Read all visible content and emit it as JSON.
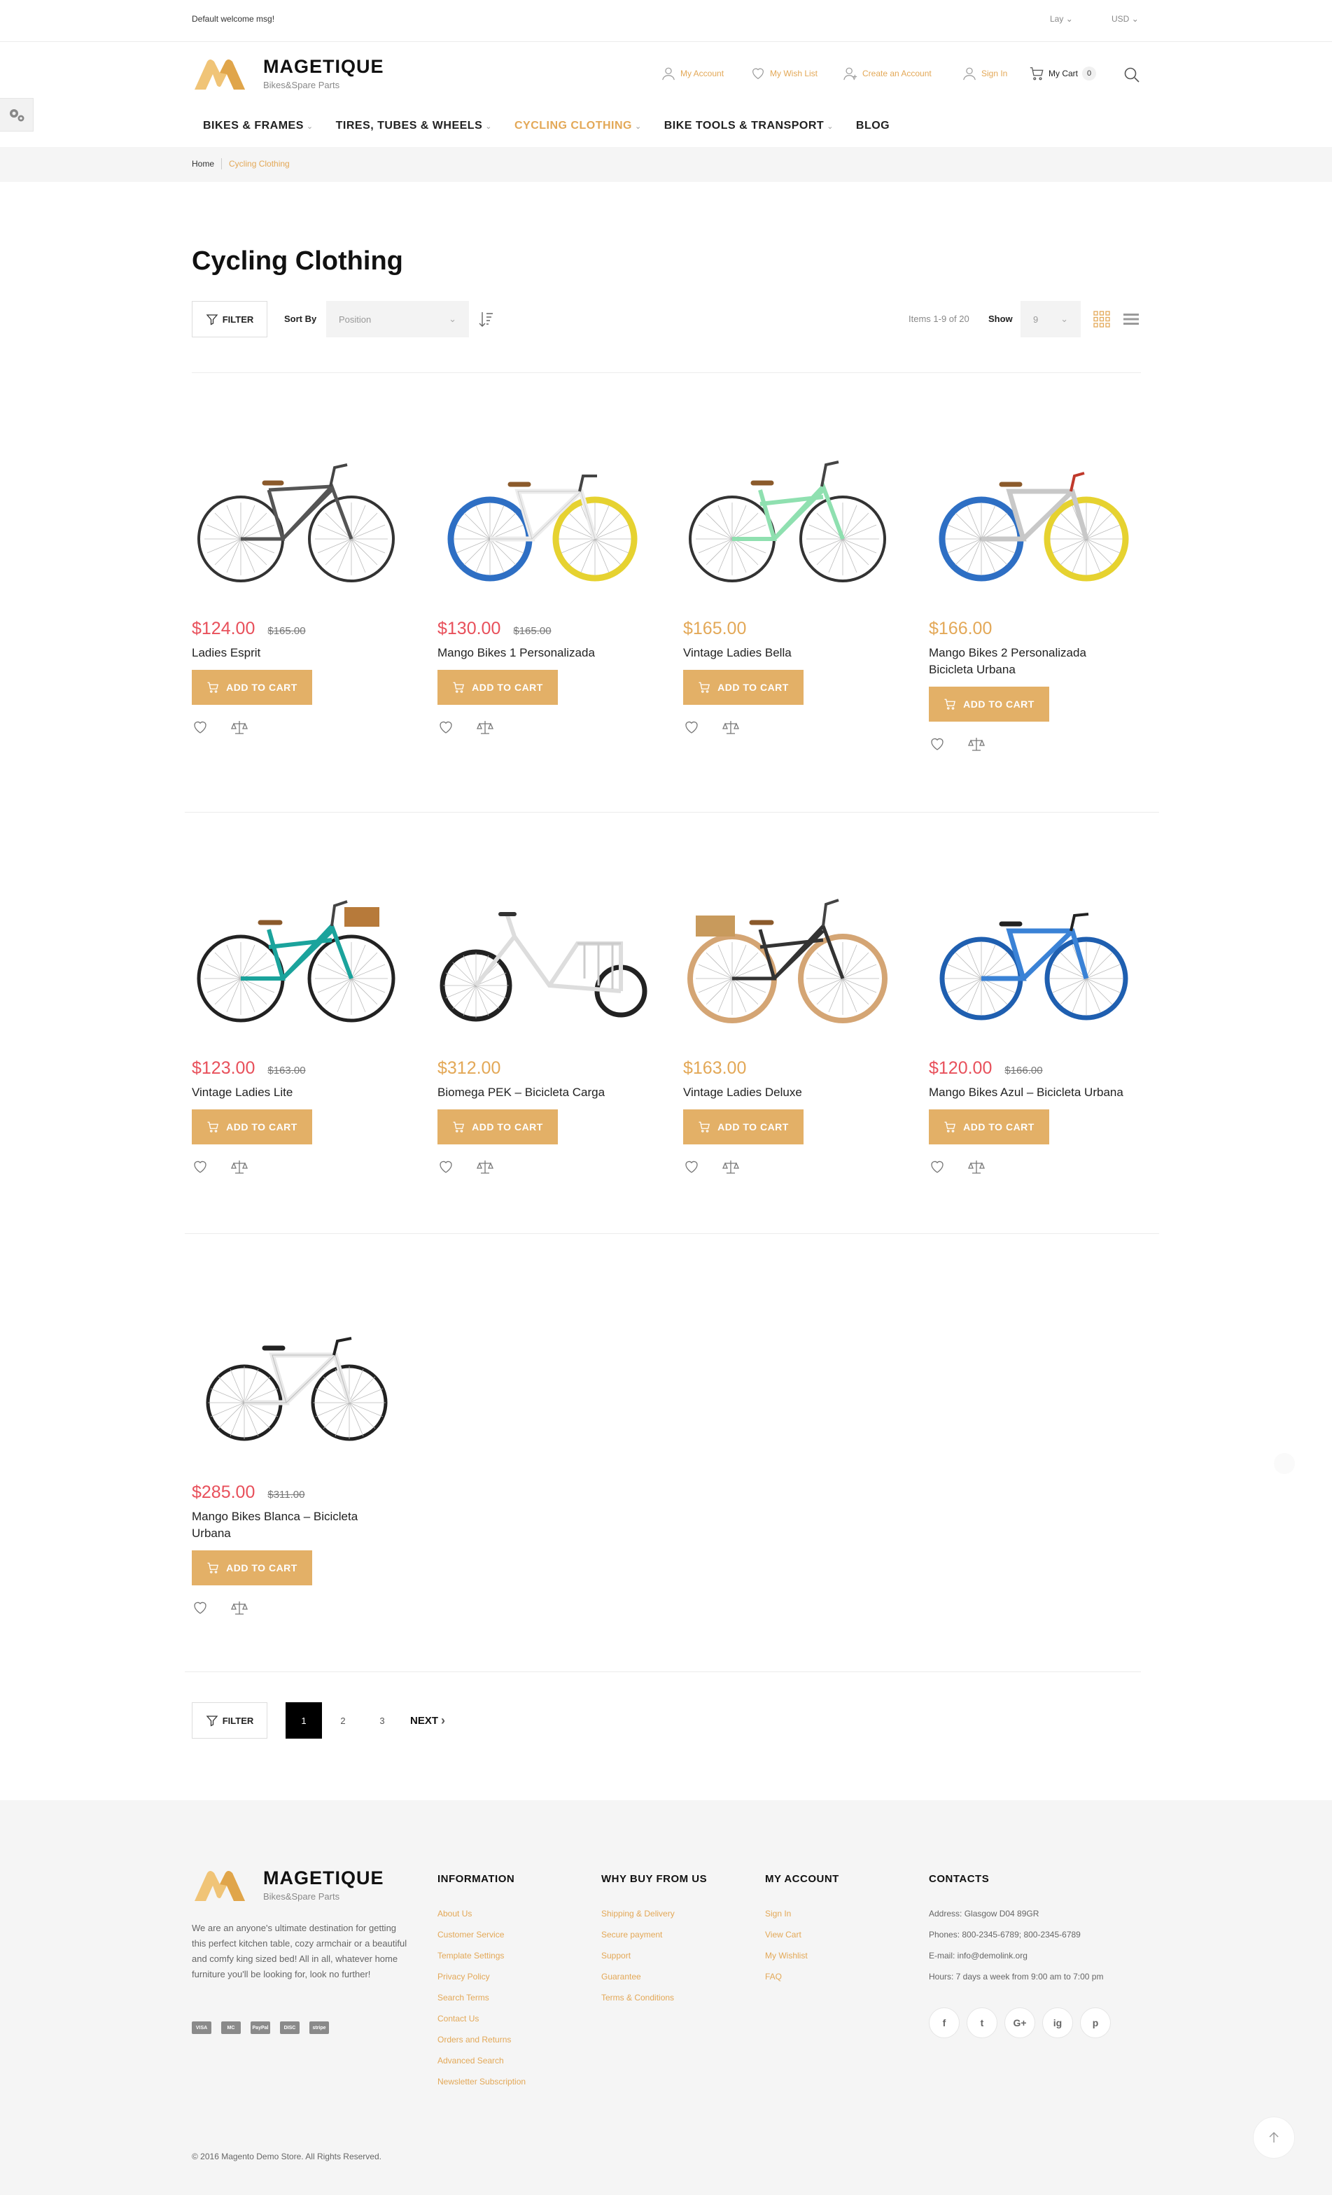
{
  "topbar": {
    "welcome": "Default welcome msg!",
    "language": "Lay",
    "currency": "USD"
  },
  "header": {
    "logo_title": "MAGETIQUE",
    "logo_subtitle": "Bikes&Spare Parts",
    "links": {
      "my_account": "My Account",
      "wish_list": "My Wish List",
      "create_account": "Create an Account",
      "sign_in": "Sign In",
      "my_cart": "My Cart",
      "cart_count": "0"
    }
  },
  "nav": [
    {
      "label": "BIKES & FRAMES",
      "active": false
    },
    {
      "label": "TIRES, TUBES & WHEELS",
      "active": false
    },
    {
      "label": "CYCLING CLOTHING",
      "active": true
    },
    {
      "label": "BIKE TOOLS & TRANSPORT",
      "active": false
    },
    {
      "label": "BLOG",
      "active": false
    }
  ],
  "breadcrumb": {
    "home": "Home",
    "current": "Cycling Clothing"
  },
  "page_title": "Cycling Clothing",
  "toolbar": {
    "filter_label": "FILTER",
    "sort_by_label": "Sort By",
    "sort_value": "Position",
    "items_count": "Items 1-9 of 20",
    "show_label": "Show",
    "show_value": "9"
  },
  "add_to_cart_label": "ADD TO CART",
  "products": [
    {
      "name": "Ladies Esprit",
      "price": "$124.00",
      "old_price": "$165.00",
      "on_sale": true
    },
    {
      "name": "Mango Bikes 1 Personalizada",
      "price": "$130.00",
      "old_price": "$165.00",
      "on_sale": true
    },
    {
      "name": "Vintage Ladies Bella",
      "price": "$165.00",
      "old_price": "",
      "on_sale": false
    },
    {
      "name": "Mango Bikes 2 Personalizada Bicicleta Urbana",
      "price": "$166.00",
      "old_price": "",
      "on_sale": false
    },
    {
      "name": "Vintage Ladies Lite",
      "price": "$123.00",
      "old_price": "$163.00",
      "on_sale": true
    },
    {
      "name": "Biomega PEK – Bicicleta Carga",
      "price": "$312.00",
      "old_price": "",
      "on_sale": false
    },
    {
      "name": "Vintage Ladies Deluxe",
      "price": "$163.00",
      "old_price": "",
      "on_sale": false
    },
    {
      "name": "Mango Bikes Azul – Bicicleta Urbana",
      "price": "$120.00",
      "old_price": "$166.00",
      "on_sale": true
    },
    {
      "name": "Mango Bikes Blanca – Bicicleta Urbana",
      "price": "$285.00",
      "old_price": "$311.00",
      "on_sale": true
    }
  ],
  "pagination": {
    "pages": [
      "1",
      "2",
      "3"
    ],
    "current": "1",
    "next_label": "NEXT"
  },
  "footer": {
    "logo_title": "MAGETIQUE",
    "logo_subtitle": "Bikes&Spare Parts",
    "about": "We are an anyone's ultimate destination for getting this perfect kitchen table, cozy armchair or a beautiful and comfy king sized bed! All in all, whatever home furniture you'll be looking for, look no further!",
    "payments": [
      "VISA",
      "MC",
      "PayPal",
      "DISC",
      "stripe"
    ],
    "information": {
      "title": "INFORMATION",
      "links": [
        "About Us",
        "Customer Service",
        "Template Settings",
        "Privacy Policy",
        "Search Terms",
        "Contact Us",
        "Orders and Returns",
        "Advanced Search",
        "Newsletter Subscription"
      ]
    },
    "why_buy": {
      "title": "WHY BUY FROM US",
      "links": [
        "Shipping & Delivery",
        "Secure payment",
        "Support",
        "Guarantee",
        "Terms & Conditions"
      ]
    },
    "my_account": {
      "title": "MY ACCOUNT",
      "links": [
        "Sign In",
        "View Cart",
        "My Wishlist",
        "FAQ"
      ]
    },
    "contacts": {
      "title": "CONTACTS",
      "address": "Address: Glasgow D04 89GR",
      "phones": "Phones: 800-2345-6789; 800-2345-6789",
      "email": "E-mail: info@demolink.org",
      "hours": "Hours: 7 days a week from 9:00 am to 7:00 pm"
    },
    "socials": [
      "f",
      "t",
      "G+",
      "ig",
      "p"
    ],
    "copyright": "© 2016 Magento Demo Store. All Rights Reserved."
  },
  "colors": {
    "accent": "#e3a857",
    "sale": "#e8505b",
    "button": "#e3b067"
  }
}
